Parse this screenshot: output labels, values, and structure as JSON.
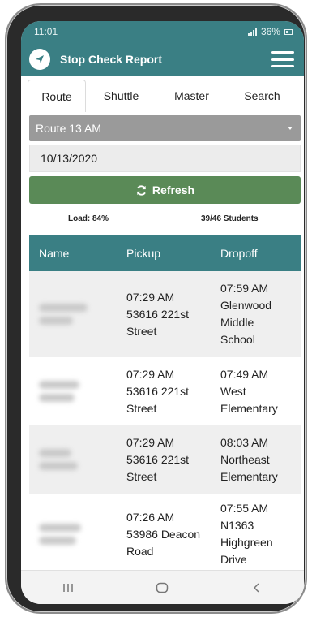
{
  "status_bar": {
    "time": "11:01",
    "battery": "36%"
  },
  "app": {
    "title": "Stop Check Report"
  },
  "tabs": [
    {
      "label": "Route",
      "active": true
    },
    {
      "label": "Shuttle",
      "active": false
    },
    {
      "label": "Master",
      "active": false
    },
    {
      "label": "Search",
      "active": false
    }
  ],
  "route_select": {
    "value": "Route 13 AM"
  },
  "date_field": {
    "value": "10/13/2020"
  },
  "refresh_button": {
    "label": "Refresh"
  },
  "stats": {
    "load": "Load: 84%",
    "students": "39/46 Students"
  },
  "table": {
    "headers": [
      "Name",
      "Pickup",
      "Dropoff"
    ],
    "rows": [
      {
        "pickup": [
          "07:29 AM",
          "53616 221st",
          "Street"
        ],
        "dropoff": [
          "07:59 AM",
          "Glenwood",
          "Middle",
          "School"
        ]
      },
      {
        "pickup": [
          "07:29 AM",
          "53616 221st",
          "Street"
        ],
        "dropoff": [
          "07:49 AM",
          "West",
          "Elementary"
        ]
      },
      {
        "pickup": [
          "07:29 AM",
          "53616 221st",
          "Street"
        ],
        "dropoff": [
          "08:03 AM",
          "Northeast",
          "Elementary"
        ]
      },
      {
        "pickup": [
          "07:26 AM",
          "53986 Deacon",
          "Road"
        ],
        "dropoff": [
          "07:55 AM",
          "N1363",
          "Highgreen",
          "Drive"
        ]
      }
    ]
  },
  "icons": {
    "logo": "bus-logo-icon",
    "menu": "hamburger-menu-icon",
    "refresh": "refresh-icon",
    "nav": [
      "recent-apps-icon",
      "home-icon",
      "back-icon"
    ]
  },
  "colors": {
    "primary": "#3a7f84",
    "refresh": "#5a8a57",
    "select": "#9a9a9a"
  }
}
